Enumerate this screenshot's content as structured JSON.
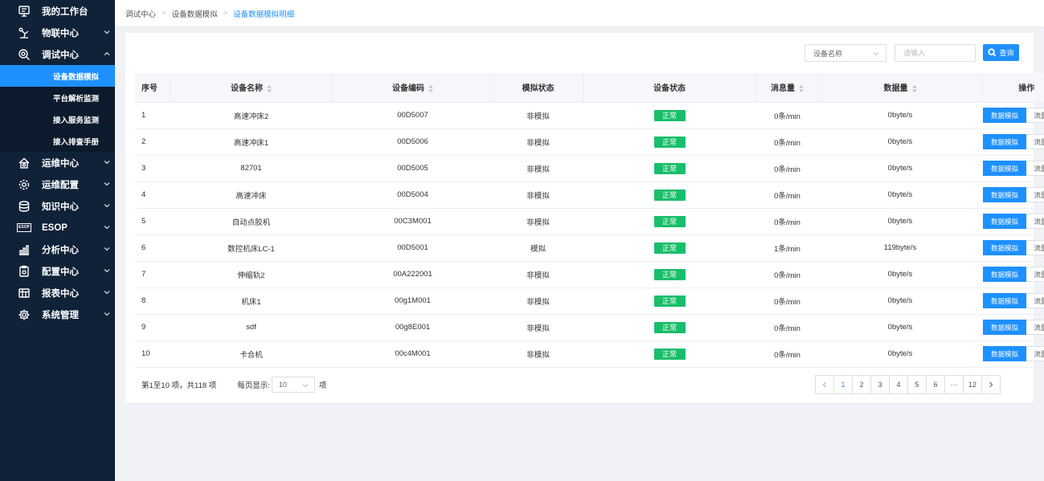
{
  "sidebar": {
    "items": [
      {
        "label": "我的工作台",
        "icon": "monitor-icon",
        "expandable": false
      },
      {
        "label": "物联中心",
        "icon": "robot-arm-icon",
        "expandable": true,
        "expanded": false
      },
      {
        "label": "调试中心",
        "icon": "debug-search-icon",
        "expandable": true,
        "expanded": true,
        "children": [
          {
            "label": "设备数据模拟",
            "active": true
          },
          {
            "label": "平台解析监测",
            "active": false
          },
          {
            "label": "接入服务监测",
            "active": false
          },
          {
            "label": "接入排查手册",
            "active": false
          }
        ]
      },
      {
        "label": "运维中心",
        "icon": "home-maintenance-icon",
        "expandable": true,
        "expanded": false
      },
      {
        "label": "运维配置",
        "icon": "gear-config-icon",
        "expandable": true,
        "expanded": false
      },
      {
        "label": "知识中心",
        "icon": "database-icon",
        "expandable": true,
        "expanded": false
      },
      {
        "label": "ESOP",
        "icon": "esop-icon",
        "icon_text": "ESOP",
        "expandable": true,
        "expanded": false
      },
      {
        "label": "分析中心",
        "icon": "bar-chart-icon",
        "expandable": true,
        "expanded": false
      },
      {
        "label": "配置中心",
        "icon": "clipboard-config-icon",
        "expandable": true,
        "expanded": false
      },
      {
        "label": "报表中心",
        "icon": "report-icon",
        "expandable": true,
        "expanded": false
      },
      {
        "label": "系统管理",
        "icon": "gear-icon",
        "expandable": true,
        "expanded": false
      }
    ]
  },
  "breadcrumb": [
    "调试中心",
    "设备数据模拟",
    "设备数据模拟明细"
  ],
  "filter": {
    "select_value": "设备名称",
    "search_placeholder": "请输入",
    "search_button_label": "查询"
  },
  "table": {
    "columns": [
      "序号",
      "设备名称",
      "设备编码",
      "模拟状态",
      "设备状态",
      "消息量",
      "数据量",
      "操作"
    ],
    "rows": [
      {
        "no": "1",
        "name": "高速冲床2",
        "code": "00D5007",
        "sim": "非模拟",
        "status": "正常",
        "msg": "0条/min",
        "data": "0byte/s"
      },
      {
        "no": "2",
        "name": "高速冲床1",
        "code": "00D5006",
        "sim": "非模拟",
        "status": "正常",
        "msg": "0条/min",
        "data": "0byte/s"
      },
      {
        "no": "3",
        "name": "82701",
        "code": "00D5005",
        "sim": "非模拟",
        "status": "正常",
        "msg": "0条/min",
        "data": "0byte/s"
      },
      {
        "no": "4",
        "name": "高速冲床",
        "code": "00D5004",
        "sim": "非模拟",
        "status": "正常",
        "msg": "0条/min",
        "data": "0byte/s"
      },
      {
        "no": "5",
        "name": "自动点胶机",
        "code": "00C3M001",
        "sim": "非模拟",
        "status": "正常",
        "msg": "0条/min",
        "data": "0byte/s"
      },
      {
        "no": "6",
        "name": "数控机床LC-1",
        "code": "00D5001",
        "sim": "模拟",
        "status": "正常",
        "msg": "1条/min",
        "data": "119byte/s"
      },
      {
        "no": "7",
        "name": "伸缩轨2",
        "code": "00A222001",
        "sim": "非模拟",
        "status": "正常",
        "msg": "0条/min",
        "data": "0byte/s"
      },
      {
        "no": "8",
        "name": "机床1",
        "code": "00g1M001",
        "sim": "非模拟",
        "status": "正常",
        "msg": "0条/min",
        "data": "0byte/s"
      },
      {
        "no": "9",
        "name": "sdf",
        "code": "00g8E001",
        "sim": "非模拟",
        "status": "正常",
        "msg": "0条/min",
        "data": "0byte/s"
      },
      {
        "no": "10",
        "name": "卡合机",
        "code": "00c4M001",
        "sim": "非模拟",
        "status": "正常",
        "msg": "0条/min",
        "data": "0byte/s"
      }
    ],
    "action_simulate": "数据模拟",
    "action_trend": "流量趋势"
  },
  "footer": {
    "summary": "第1至10 项，共118 项",
    "per_page_label": "每页显示:",
    "per_page_value": "10",
    "per_page_suffix": "项"
  },
  "pagination": {
    "pages": [
      "1",
      "2",
      "3",
      "4",
      "5",
      "6",
      "···",
      "12"
    ],
    "current": "1"
  },
  "colors": {
    "sidebar_bg": "#0f2238",
    "accent": "#1e90ff",
    "status_ok": "#19be6b"
  }
}
